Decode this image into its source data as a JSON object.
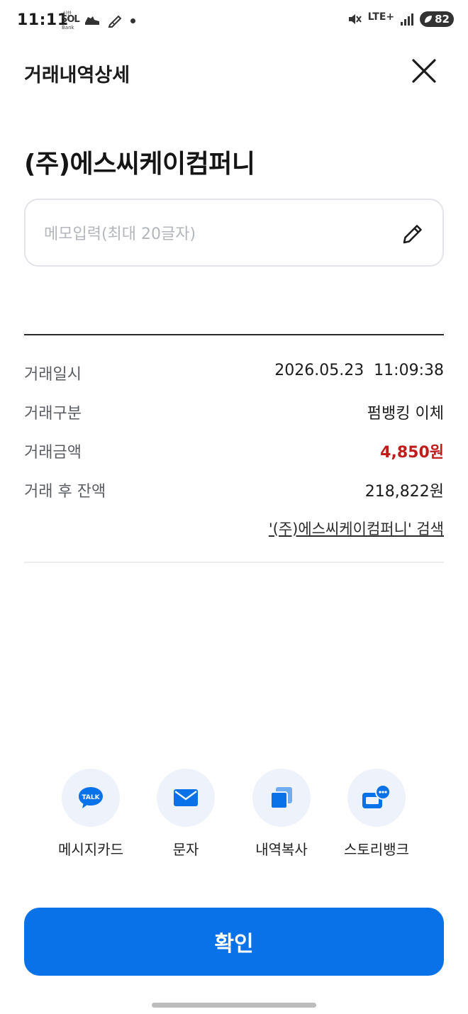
{
  "status_bar": {
    "time": "11:11",
    "network": "LTE+",
    "battery": "82"
  },
  "header": {
    "title": "거래내역상세"
  },
  "merchant": {
    "name": "(주)에스씨케이컴퍼니"
  },
  "memo": {
    "placeholder": "메모입력(최대 20글자)",
    "value": ""
  },
  "details": [
    {
      "label": "거래일시",
      "value": "2026.05.23  11:09:38"
    },
    {
      "label": "거래구분",
      "value": "펌뱅킹 이체"
    },
    {
      "label": "거래금액",
      "value": "4,850원"
    },
    {
      "label": "거래 후 잔액",
      "value": "218,822원"
    }
  ],
  "search_link": "'(주)에스씨케이컴퍼니' 검색",
  "share": [
    {
      "label": "메시지카드",
      "icon": "kakaotalk-icon",
      "icon_text": "TALK"
    },
    {
      "label": "문자",
      "icon": "envelope-icon"
    },
    {
      "label": "내역복사",
      "icon": "copy-icon"
    },
    {
      "label": "스토리뱅크",
      "icon": "chat-bubble-icon"
    }
  ],
  "confirm_button": "확인",
  "colors": {
    "primary": "#0a72e8",
    "amount": "#c01c1c",
    "icon_bg": "#eef3fb"
  }
}
